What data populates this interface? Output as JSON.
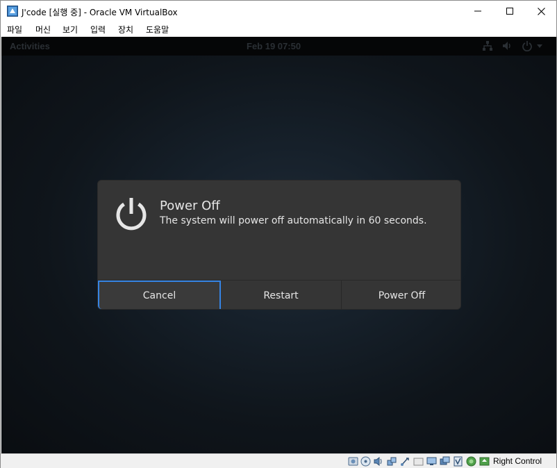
{
  "window": {
    "title": "J'code [실행 중] - Oracle VM VirtualBox"
  },
  "menubar": {
    "items": [
      "파일",
      "머신",
      "보기",
      "입력",
      "장치",
      "도움말"
    ]
  },
  "gnome_topbar": {
    "activities": "Activities",
    "clock": "Feb 19  07:50",
    "tray_icons": [
      "network-icon",
      "volume-icon",
      "power-icon"
    ]
  },
  "dialog": {
    "title": "Power Off",
    "message": "The system will power off automatically in 60 seconds.",
    "buttons": {
      "cancel": "Cancel",
      "restart": "Restart",
      "power_off": "Power Off"
    },
    "focused_button": "cancel"
  },
  "statusbar": {
    "host_key_label": "Right Control",
    "icons": [
      "hard-disk-icon",
      "optical-drive-icon",
      "audio-icon",
      "network-icon",
      "usb-icon",
      "shared-folders-icon",
      "display-icon",
      "video-capture-icon",
      "mouse-integration-icon",
      "guest-additions-icon",
      "keyboard-capture-icon"
    ]
  },
  "colors": {
    "accent": "#3584e4",
    "dialog_bg": "#353535",
    "screen_bg": "#0d1014"
  }
}
